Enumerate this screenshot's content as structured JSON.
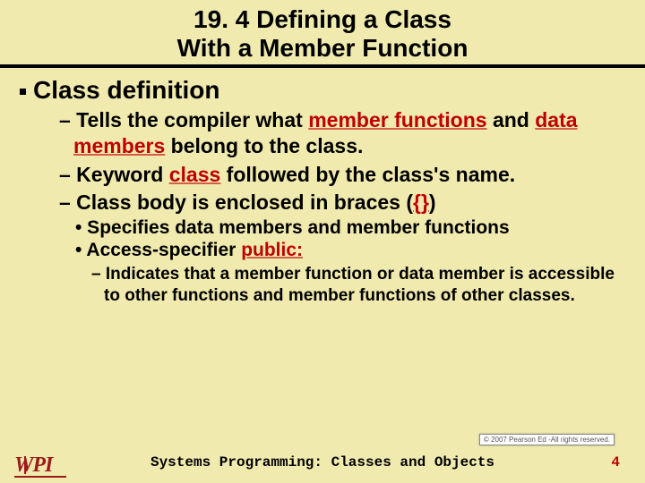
{
  "title": {
    "line1": "19. 4 Defining a Class",
    "line2": "With a Member Function"
  },
  "heading": "Class definition",
  "bullet1": {
    "pre": "– Tells the compiler what ",
    "hl1": "member functions",
    "mid": " and ",
    "hl2": "data members",
    "post": " belong to the class."
  },
  "bullet2": {
    "pre": "– Keyword ",
    "hl": "class",
    "post": " followed by the class's name."
  },
  "bullet3": {
    "pre": "– Class body is enclosed in braces (",
    "hl": "{}",
    "post": ")"
  },
  "sub1": "• Specifies data members and member functions",
  "sub2": {
    "pre": "• Access-specifier ",
    "hl": "public:"
  },
  "subsub": "– Indicates that a member function or data member is accessible to other functions and member functions of other classes.",
  "copyright": "© 2007 Pearson Ed -All rights reserved.",
  "footer": "Systems Programming:  Classes and Objects",
  "page": "4",
  "logo": {
    "left": "W",
    "right": "PI"
  }
}
